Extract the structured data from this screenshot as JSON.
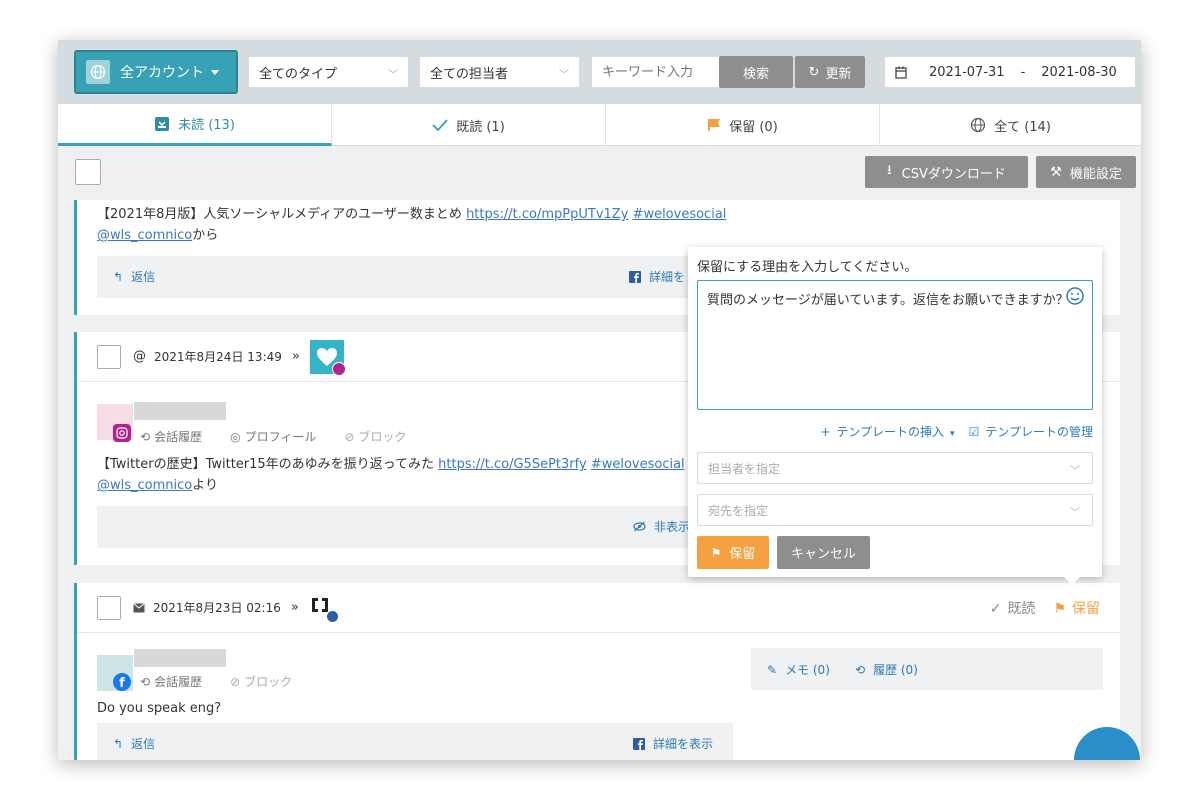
{
  "toolbar": {
    "account_label": "全アカウント",
    "type_select": "全てのタイプ",
    "assignee_select": "全ての担当者",
    "keyword_placeholder": "キーワード入力",
    "search_label": "検索",
    "refresh_label": "更新",
    "date_from": "2021-07-31",
    "date_sep": "-",
    "date_to": "2021-08-30"
  },
  "tabs": [
    {
      "label": "未読 (13)",
      "active": true
    },
    {
      "label": "既読 (1)",
      "active": false
    },
    {
      "label": "保留 (0)",
      "active": false
    },
    {
      "label": "全て (14)",
      "active": false
    }
  ],
  "actions": {
    "csv_label": "CSVダウンロード",
    "settings_label": "機能設定"
  },
  "messages": [
    {
      "text_prefix": "【2021年8月版】人気ソーシャルメディアのユーザー数まとめ ",
      "link": "https://t.co/mpPpUTv1Zy",
      "hashtag": "#welovesocial",
      "mention": "@wls_comnico",
      "suffix": "から",
      "reply_label": "返信",
      "detail_label": "詳細を"
    },
    {
      "date": "2021年8月24日 13:49",
      "history_label": "会話履歴",
      "profile_label": "プロフィール",
      "block_label": "ブロック",
      "text_prefix": "【Twitterの歴史】Twitter15年のあゆみを振り返ってみた ",
      "link": "https://t.co/G5SePt3rfy",
      "hashtag": "#welovesocial",
      "mention": "@wls_comnico",
      "suffix": "より",
      "hide_label": "非表示"
    },
    {
      "date": "2021年8月23日 02:16",
      "read_label": "既読",
      "hold_label": "保留",
      "history_label": "会話履歴",
      "block_label": "ブロック",
      "memo_label": "メモ (0)",
      "log_label": "履歴 (0)",
      "text": "Do you speak eng?",
      "reply_label": "返信",
      "detail_label": "詳細を表示"
    }
  ],
  "popup": {
    "title": "保留にする理由を入力してください。",
    "reason_text": "質問のメッセージが届いています。返信をお願いできますか？",
    "insert_template": "テンプレートの挿入",
    "manage_template": "テンプレートの管理",
    "assignee_placeholder": "担当者を指定",
    "recipient_placeholder": "宛先を指定",
    "hold_button": "保留",
    "cancel_button": "キャンセル"
  },
  "colors": {
    "accent": "#36a2b4",
    "hold": "#f5a141",
    "gray_button": "#8e8e8e",
    "link": "#3b78c4"
  }
}
